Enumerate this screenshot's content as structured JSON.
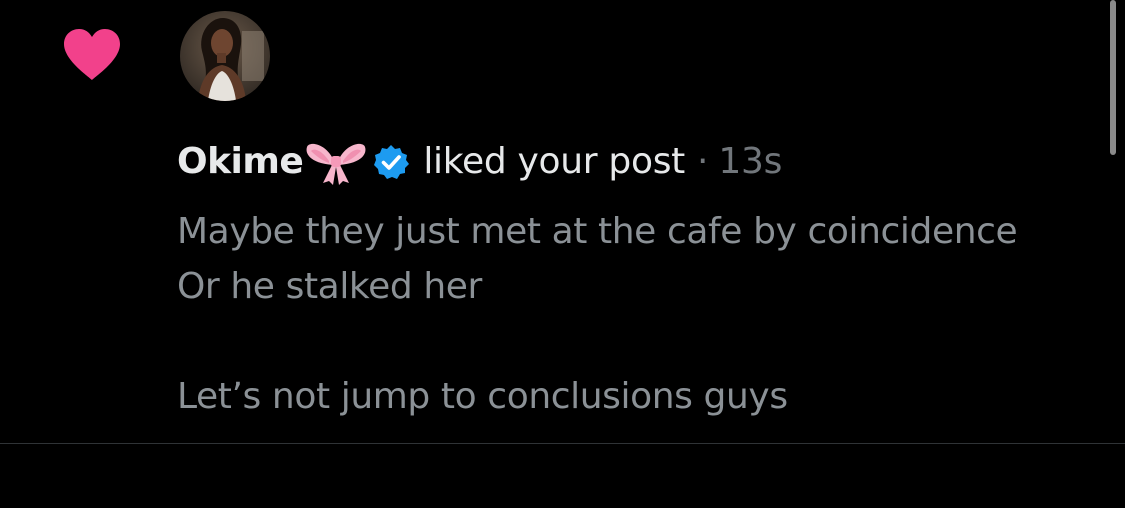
{
  "notification": {
    "type_icon": "heart-icon",
    "type_icon_color": "#f2418b",
    "avatar": "user-avatar",
    "user": {
      "display_name": "Okime",
      "name_emoji": "bow-icon",
      "verified_badge": "verified-icon",
      "verified_color": "#1d9bf0"
    },
    "action": "liked your post",
    "separator": "·",
    "time": "13s",
    "post_text_lines": [
      "Maybe they just met at the cafe by coincidence",
      "Or he stalked her",
      "",
      "Let’s not jump to conclusions guys"
    ]
  },
  "colors": {
    "background": "#000000",
    "primary_text": "#e7e9ea",
    "secondary_text": "#71767b",
    "preview_text": "#8b9196",
    "divider": "#2f3336"
  }
}
